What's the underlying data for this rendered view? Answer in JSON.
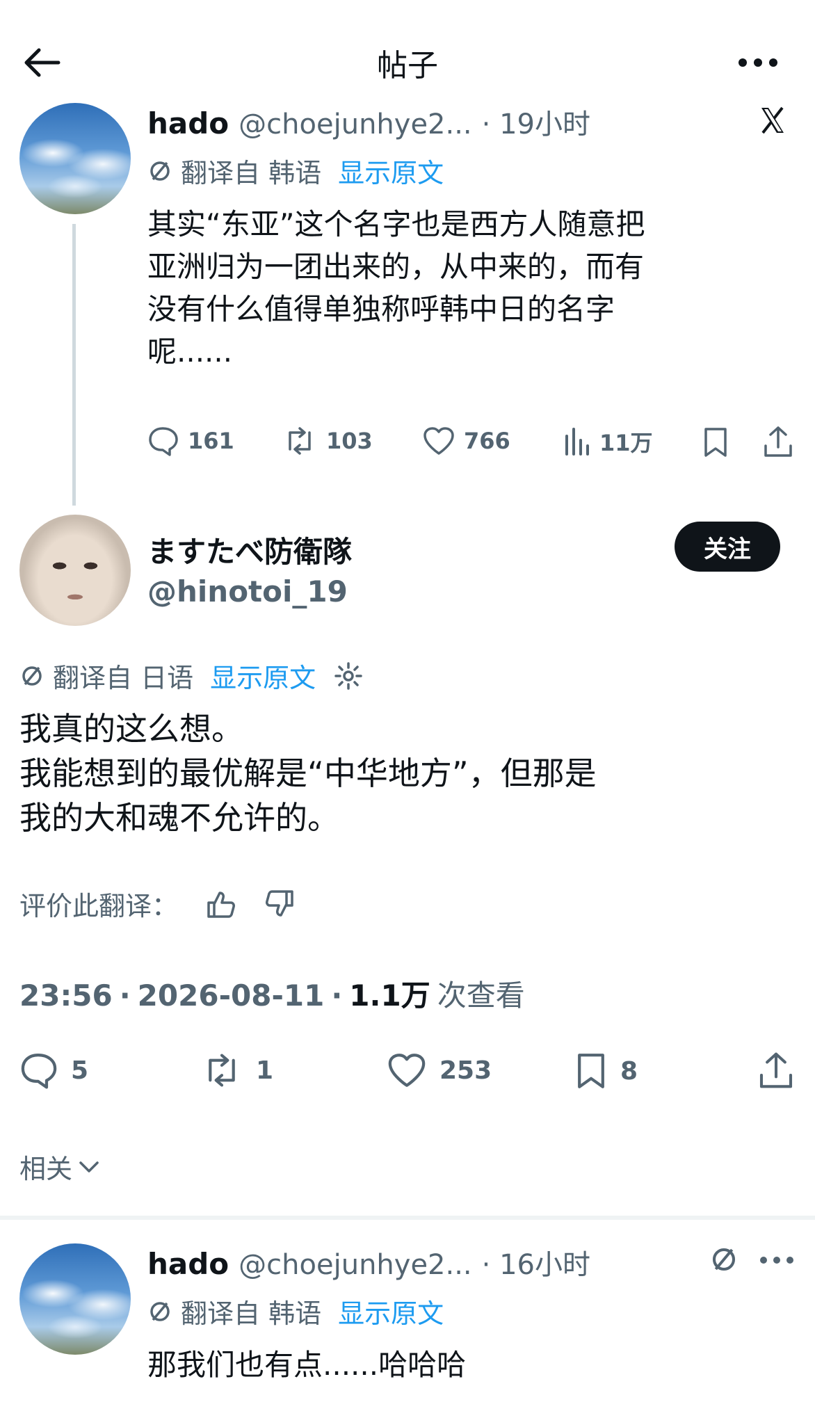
{
  "header": {
    "title": "帖子"
  },
  "parent_post": {
    "author_name": "hado",
    "handle": "@choejunhye2...",
    "time": "· 19小时",
    "translation_note": "翻译自 韩语",
    "show_original": "显示原文",
    "text_lines": [
      "其实“东亚”这个名字也是西方人随意把",
      "亚洲归为一团出来的，从中来的，而有",
      "没有什么值得单独称呼韩中日的名字",
      "呢......"
    ],
    "stats": {
      "replies": "161",
      "reposts": "103",
      "likes": "766",
      "views": "11万"
    }
  },
  "main_post": {
    "author_name": "ますたべ防衛隊",
    "handle": "@hinotoi_19",
    "follow_label": "关注",
    "translation_note": "翻译自 日语",
    "show_original": "显示原文",
    "text_lines": [
      "我真的这么想。",
      "我能想到的最优解是“中华地方”，但那是",
      "我的大和魂不允许的。"
    ],
    "rate_translation": "评价此翻译：",
    "time": "23:56",
    "date": "2026-08-11",
    "views_count": "1.1万",
    "views_label": "次查看",
    "stats": {
      "replies": "5",
      "reposts": "1",
      "likes": "253",
      "bookmarks": "8"
    }
  },
  "related": {
    "label": "相关"
  },
  "reply_post": {
    "author_name": "hado",
    "handle": "@choejunhye2...",
    "time": "· 16小时",
    "translation_note": "翻译自 韩语",
    "show_original": "显示原文",
    "text": "那我们也有点......哈哈哈"
  }
}
